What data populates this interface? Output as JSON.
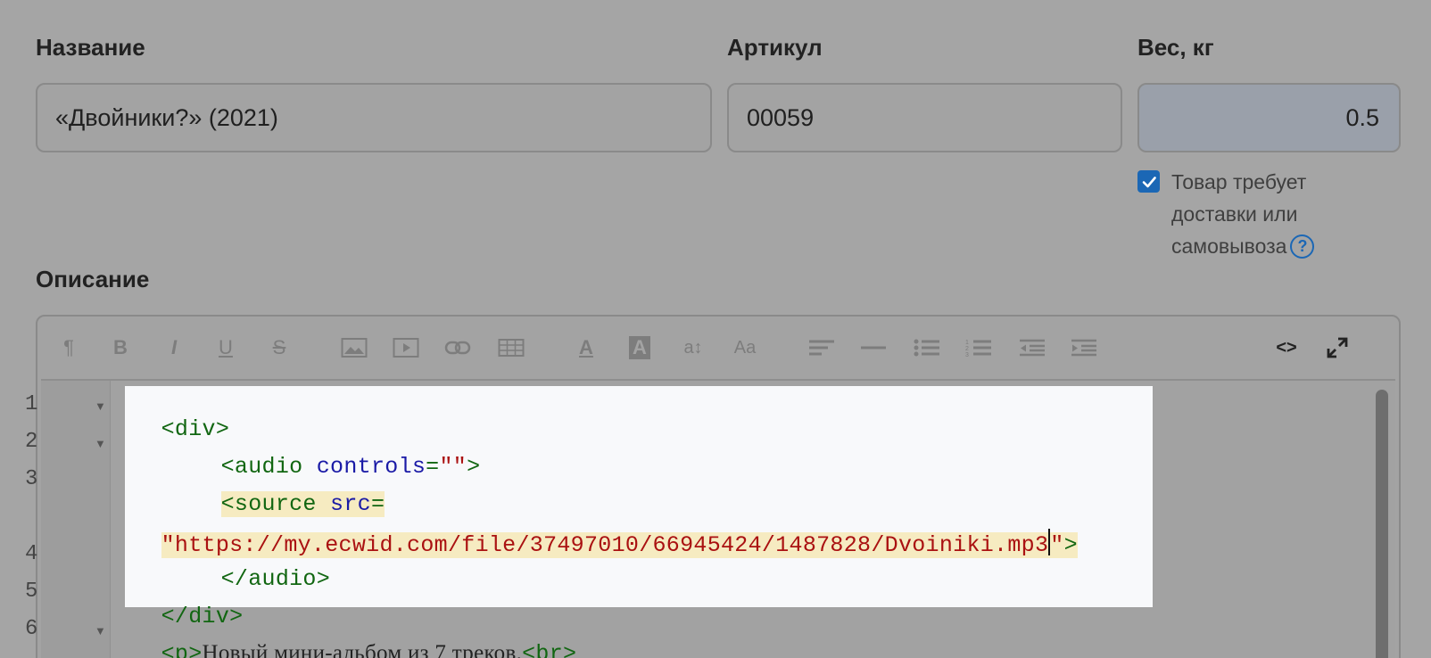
{
  "form": {
    "name_label": "Название",
    "name_value": "«Двойники?» (2021)",
    "sku_label": "Артикул",
    "sku_value": "00059",
    "weight_label": "Вес, кг",
    "weight_value": "0.5",
    "shipping_checkbox_label": "Товар требует доставки или самовывоза",
    "shipping_checked": true,
    "help_glyph": "?",
    "description_label": "Описание"
  },
  "toolbar": {
    "icons": [
      "paragraph-icon",
      "bold-icon",
      "italic-icon",
      "underline-icon",
      "strikethrough-icon",
      "image-icon",
      "video-icon",
      "link-icon",
      "table-icon",
      "font-color-icon",
      "background-color-icon",
      "line-height-icon",
      "font-size-icon",
      "align-icon",
      "horizontal-line-icon",
      "bullet-list-icon",
      "numbered-list-icon",
      "outdent-icon",
      "indent-icon",
      "code-view-icon",
      "fullscreen-icon"
    ],
    "glyphs": {
      "paragraph": "¶",
      "bold": "B",
      "italic": "I",
      "underline": "U",
      "strike": "S",
      "font_color": "A",
      "bg_color": "A",
      "line_height": "a↕",
      "font_size": "Aa",
      "code_view": "<>"
    }
  },
  "code": {
    "line_numbers": [
      "1",
      "2",
      "3",
      "",
      "4",
      "5",
      "6"
    ],
    "lines": {
      "l1_tag": "<div>",
      "l2_tag_open": "<audio",
      "l2_attr": "controls",
      "l2_eq": "=",
      "l2_val": "\"\"",
      "l2_close": ">",
      "l3_tag": "<source",
      "l3_attr": "src",
      "l3_eq": "=",
      "l3_url": "\"https://my.ecwid.com/file/37497010/66945424/1487828/Dvoiniki.mp3",
      "l3_quote": "\"",
      "l3_close": ">",
      "l4_tag": "</audio>",
      "l5_tag": "</div>",
      "l6_tag_open": "<p>",
      "l6_text": "Новый мини-альбом из 7 треков.",
      "l6_br": "<br>"
    }
  }
}
